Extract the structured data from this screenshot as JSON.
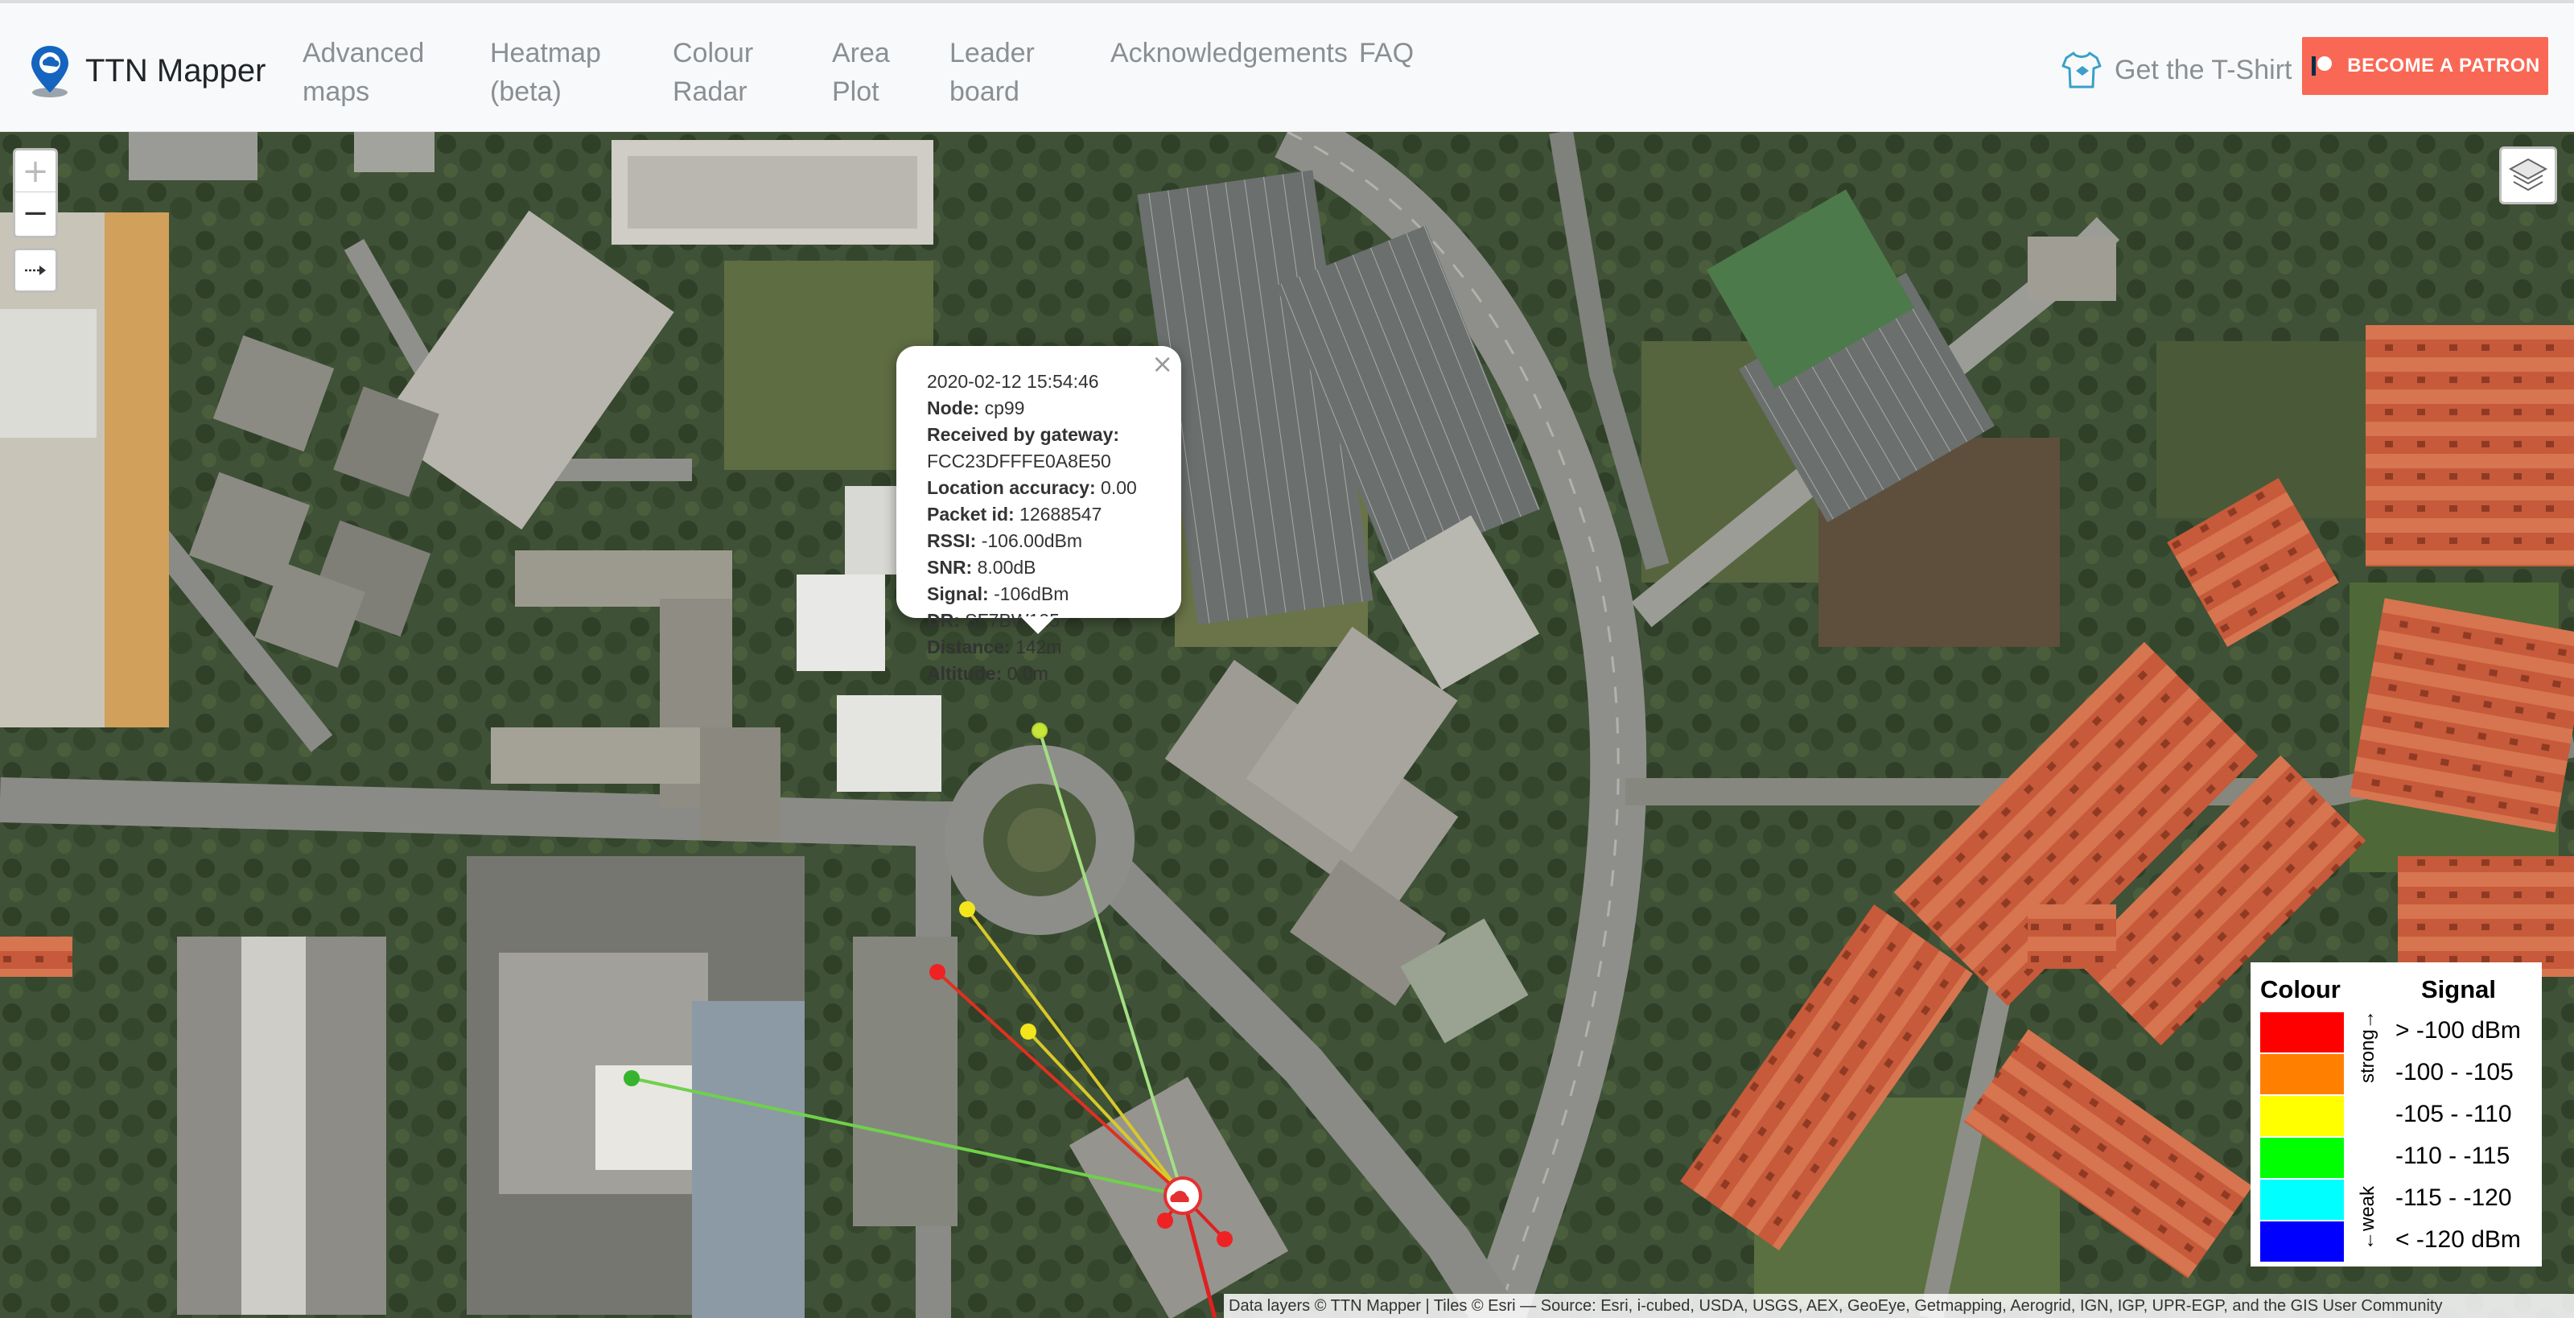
{
  "brand": {
    "name": "TTN Mapper",
    "icon": "map-pin-cloud-icon"
  },
  "nav": {
    "items": [
      {
        "line1": "Advanced",
        "line2": "maps"
      },
      {
        "line1": "Heatmap",
        "line2": "(beta)"
      },
      {
        "line1": "Colour",
        "line2": "Radar"
      },
      {
        "line1": "Area",
        "line2": "Plot"
      },
      {
        "line1": "Leader",
        "line2": "board"
      },
      {
        "line1": "Acknowledgements",
        "line2": ""
      },
      {
        "line1": "FAQ",
        "line2": ""
      }
    ],
    "tshirt_label": "Get the T-Shirt",
    "tshirt_icon": "tshirt-icon",
    "patron_label": "BECOME A PATRON",
    "patron_color": "#f96854"
  },
  "map_controls": {
    "zoom_in": "+",
    "zoom_out": "−",
    "expand": "⇢",
    "layers_icon": "layers-icon"
  },
  "popup": {
    "close": "×",
    "timestamp": "2020-02-12 15:54:46",
    "fields": [
      {
        "label": "Node:",
        "value": "cp99"
      },
      {
        "label": "Received by gateway:",
        "value": ""
      },
      {
        "label": "",
        "value": "FCC23DFFFE0A8E50"
      },
      {
        "label": "Location accuracy:",
        "value": "0.00"
      },
      {
        "label": "Packet id:",
        "value": "12688547"
      },
      {
        "label": "RSSI:",
        "value": "-106.00dBm"
      },
      {
        "label": "SNR:",
        "value": "8.00dB"
      },
      {
        "label": "Signal:",
        "value": "-106dBm"
      },
      {
        "label": "DR:",
        "value": "SF7BW125"
      },
      {
        "label": "Distance:",
        "value": "142m"
      },
      {
        "label": "Altitude:",
        "value": "0.0m"
      }
    ]
  },
  "legend": {
    "col1": "Colour",
    "col2": "Signal",
    "strong": "strong→",
    "weak": "←weak",
    "rows": [
      {
        "color": "#ff0000",
        "label": "> -100 dBm"
      },
      {
        "color": "#ff7f00",
        "label": "-100 - -105"
      },
      {
        "color": "#ffff00",
        "label": "-105 - -110"
      },
      {
        "color": "#00ff00",
        "label": "-110 - -115"
      },
      {
        "color": "#00ffff",
        "label": "-115 - -120"
      },
      {
        "color": "#0000ff",
        "label": "< -120 dBm"
      }
    ]
  },
  "attribution": "Data layers © TTN Mapper | Tiles © Esri — Source: Esri, i-cubed, USDA, USGS, AEX, GeoEye, Getmapping, Aerogrid, IGN, IGP, UPR-EGP, and the GIS User Community"
}
